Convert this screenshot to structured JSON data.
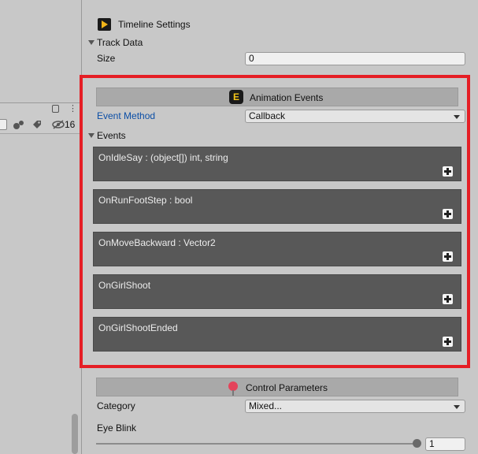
{
  "timeline_settings": {
    "title": "Timeline Settings",
    "icon": "timeline-icon"
  },
  "track_data": {
    "label": "Track Data",
    "size_label": "Size",
    "size_value": "0"
  },
  "animation_events": {
    "title": "Animation Events",
    "icon": "e-badge-icon",
    "event_method_label": "Event Method",
    "event_method_value": "Callback",
    "events_label": "Events",
    "events": [
      {
        "name": "OnIdleSay : (object[]) int, string"
      },
      {
        "name": "OnRunFootStep : bool"
      },
      {
        "name": "OnMoveBackward : Vector2"
      },
      {
        "name": "OnGirlShoot"
      },
      {
        "name": "OnGirlShootEnded"
      }
    ]
  },
  "control_parameters": {
    "title": "Control Parameters",
    "icon": "pin-icon",
    "category_label": "Category",
    "category_value": "Mixed...",
    "eye_blink_label": "Eye Blink",
    "eye_blink_value": "1",
    "eye_blink_fraction": 0.99
  },
  "left_toolbar": {
    "layer_count": "16"
  },
  "colors": {
    "highlight": "#e51e25",
    "event_block": "#585858",
    "link_label": "#0b4ea6"
  }
}
